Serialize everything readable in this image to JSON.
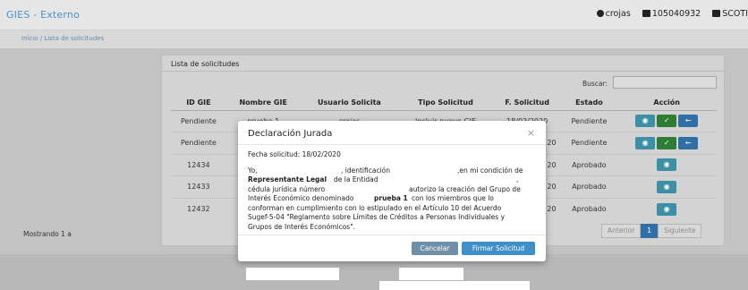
{
  "app": {
    "title": "GIES - Externo",
    "user": "crojas",
    "id_number": "105040932",
    "org": "SCOTI"
  },
  "breadcrumb": "Inicio / Lista de solicitudes",
  "panel": {
    "title": "Lista de solicitudes",
    "search_label": "Buscar:",
    "search_value": ""
  },
  "table": {
    "columns": [
      "ID GIE",
      "Nombre GIE",
      "Usuario Solicita",
      "Tipo Solicitud",
      "F. Solicitud",
      "Estado",
      "Acción"
    ],
    "rows": [
      [
        "Pendiente",
        "prueba 1",
        "crojas",
        "Incluir nuevo GIE",
        "18/02/2020",
        "Pendiente"
      ],
      [
        "Pendiente",
        "",
        "",
        "",
        "20",
        "Pendiente"
      ],
      [
        "12434",
        "",
        "",
        "",
        "20",
        "Aprobado"
      ],
      [
        "12433",
        "",
        "",
        "",
        "20",
        "Aprobado"
      ],
      [
        "12432",
        "",
        "",
        "",
        "20",
        "Aprobado"
      ]
    ]
  },
  "footer": {
    "showing": "Mostrando 1 a",
    "prev": "Anterior",
    "page": "1",
    "next": "Siguiente"
  },
  "modal": {
    "title": "Declaración Jurada",
    "close": "×",
    "date_line": "Fecha solicitud: 18/02/2020",
    "l1_a": "Yo,",
    "l1_b": ", identificación",
    "l1_c": ",en mi condición de",
    "l2_bold": "Representante Legal",
    "l2_rest": "de la Entidad",
    "l2_comma": ",",
    "l3_a": "cédula jurídica número",
    "l3_b": "autorizo la creación del Grupo de",
    "l4_a": "Interés Económico denominado",
    "l4_bold": "prueba 1",
    "l4_b": "con los miembros que lo",
    "l5": "conforman en cumplimiento con lo estipulado en el Artículo 10 del Acuerdo",
    "l6": "Sugef-5-04 \"Reglamento sobre Límites de Créditos a Personas Individuales y",
    "l7": "Grupos de Interés Económicos\".",
    "cancel": "Cancelar",
    "sign": "Firmar Solicitud"
  }
}
